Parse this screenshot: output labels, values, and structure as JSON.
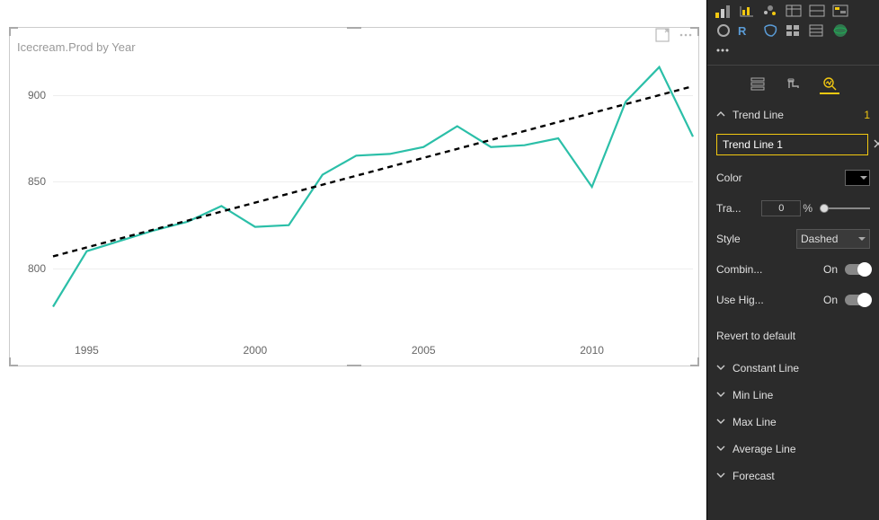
{
  "chart": {
    "title": "Icecream.Prod by Year",
    "icons": {
      "focus": "focus-mode-icon",
      "more": "more-options-icon"
    }
  },
  "chart_data": {
    "type": "line",
    "x": [
      1994,
      1995,
      1996,
      1997,
      1998,
      1999,
      2000,
      2001,
      2002,
      2003,
      2004,
      2005,
      2006,
      2007,
      2008,
      2009,
      2010,
      2011,
      2012,
      2013
    ],
    "series": [
      {
        "name": "Icecream.Prod",
        "color": "#2bbfa8",
        "values": [
          778,
          810,
          816,
          822,
          827,
          836,
          824,
          825,
          854,
          865,
          866,
          870,
          882,
          870,
          871,
          875,
          847,
          896,
          916,
          876
        ]
      }
    ],
    "trend": {
      "name": "Trend Line 1",
      "style": "dashed",
      "color": "#000000",
      "start_y": 807,
      "end_y": 905
    },
    "xlabel": "",
    "ylabel": "",
    "x_ticks": [
      1995,
      2000,
      2005,
      2010
    ],
    "y_ticks": [
      800,
      850,
      900
    ],
    "ylim": [
      770,
      920
    ],
    "xlim": [
      1994,
      2013
    ]
  },
  "sidebar": {
    "panel_tabs": [
      "fields",
      "format",
      "analytics"
    ],
    "active_tab": "analytics",
    "expanded_section": {
      "label": "Trend Line",
      "count": "1"
    },
    "trend_props": {
      "name_value": "Trend Line 1",
      "color_label": "Color",
      "color_value": "#000000",
      "transparency_label": "Tra...",
      "transparency_value": "0",
      "transparency_unit": "%",
      "style_label": "Style",
      "style_value": "Dashed",
      "combine_label": "Combin...",
      "combine_state": "On",
      "highlight_label": "Use Hig...",
      "highlight_state": "On",
      "revert_label": "Revert to default"
    },
    "collapsed_sections": [
      "Constant Line",
      "Min Line",
      "Max Line",
      "Average Line",
      "Forecast"
    ]
  }
}
